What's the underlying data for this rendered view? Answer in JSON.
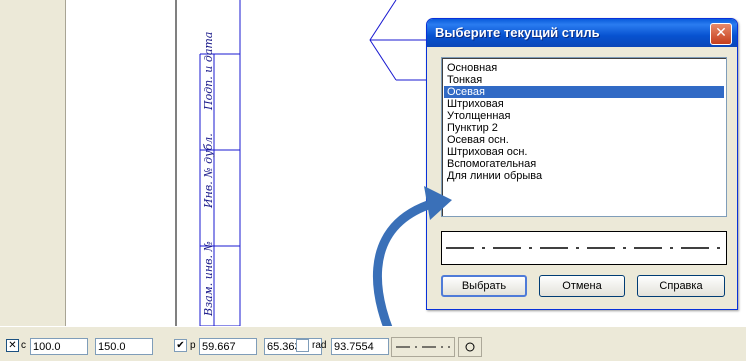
{
  "stamp": {
    "labels": [
      "Подп. и дата",
      "Инв. № дубл.",
      "Взам. инв. №"
    ]
  },
  "dialog": {
    "title": "Выберите текущий стиль",
    "close_icon": "close-icon",
    "items": [
      "Основная",
      "Тонкая",
      "Осевая",
      "Штриховая",
      "Утолщенная",
      "Пунктир 2",
      "Осевая осн.",
      "Штриховая осн.",
      "Вспомогательная",
      "Для линии обрыва"
    ],
    "selected_index": 2,
    "preview_icon": "dash-dot-line-preview",
    "buttons": {
      "select": "Выбрать",
      "cancel": "Отмена",
      "help": "Справка"
    }
  },
  "statusbar": {
    "x_label": "c",
    "x_value": "100.0",
    "y_value": "150.0",
    "p_label": "p",
    "p_value1": "59.667",
    "p_value2": "65.363",
    "rad_label": "rad",
    "rad_value": "93.7554",
    "line_style_icon": "dash-dot-line-icon",
    "circle_icon": "circle-icon"
  },
  "colors": {
    "drawing_line": "#1a1ad0",
    "selection": "#316ac5",
    "arrow": "#3a70b8",
    "title_bar": "#0a5bdb"
  }
}
